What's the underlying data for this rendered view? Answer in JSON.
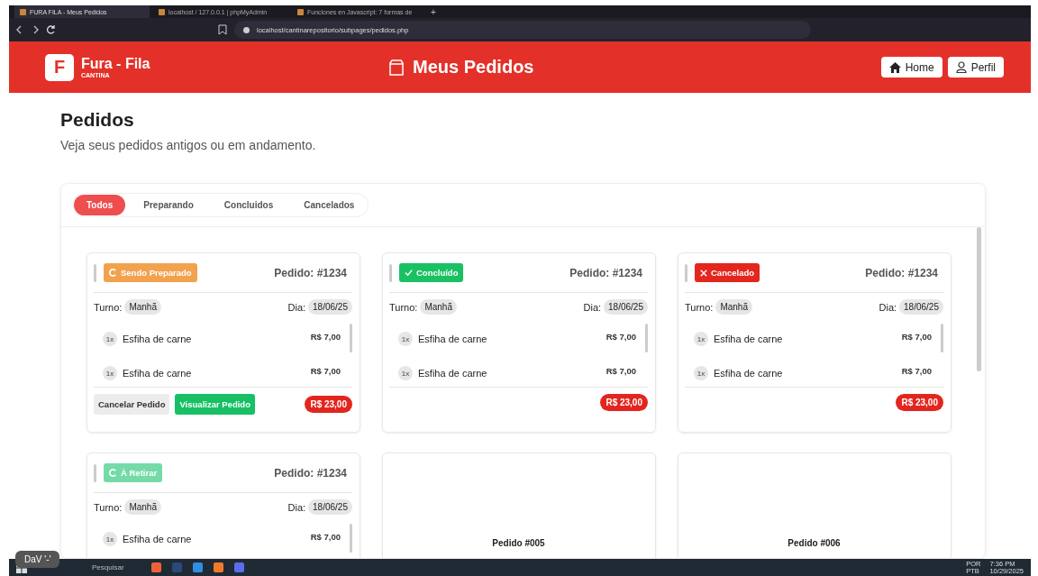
{
  "browser": {
    "tabs": [
      {
        "title": "FURA FILA - Meus Pedidos",
        "selected": true
      },
      {
        "title": "localhost / 127.0.0.1 | phpMyAdmin",
        "selected": false
      },
      {
        "title": "Funciones en Javascript: 7 formas de",
        "selected": false
      }
    ],
    "new_tab": "+",
    "url": "localhost/cantinarepositorio/subpages/pedidos.php"
  },
  "header": {
    "logo_letter": "F",
    "brand": "Fura - Fila",
    "subtitle": "CANTINA",
    "title": "Meus Pedidos",
    "buttons": [
      {
        "label": "Home",
        "kind": "home"
      },
      {
        "label": "Perfil",
        "kind": "profile"
      }
    ]
  },
  "page": {
    "title": "Pedidos",
    "subtitle": "Veja seus pedidos antigos ou em andamento."
  },
  "filters": [
    {
      "label": "Todos",
      "selected": true
    },
    {
      "label": "Preparando",
      "selected": false
    },
    {
      "label": "Concluidos",
      "selected": false
    },
    {
      "label": "Cancelados",
      "selected": false
    }
  ],
  "orders": [
    {
      "kind": "order",
      "badge": {
        "kind": "preparing",
        "label": "Sendo Preparado"
      },
      "number": "Pedido: #1234",
      "shift_label": "Turno:",
      "shift": "Manhã",
      "day_label": "Dia:",
      "date": "18/06/25",
      "items": [
        {
          "qty": "1x",
          "name": "Esfiha de carne",
          "price": "R$ 7,00"
        },
        {
          "qty": "1x",
          "name": "Esfiha de carne",
          "price": "R$ 7,00"
        }
      ],
      "actions": [
        {
          "label": "Cancelar Pedido",
          "kind": "cancel"
        },
        {
          "label": "Visualizar Pedido",
          "kind": "view"
        }
      ],
      "total": "R$ 23,00"
    },
    {
      "kind": "order",
      "badge": {
        "kind": "done",
        "label": "Concluído"
      },
      "number": "Pedido: #1234",
      "shift_label": "Turno:",
      "shift": "Manhã",
      "day_label": "Dia:",
      "date": "18/06/25",
      "items": [
        {
          "qty": "1x",
          "name": "Esfiha de carne",
          "price": "R$ 7,00"
        },
        {
          "qty": "1x",
          "name": "Esfiha de carne",
          "price": "R$ 7,00"
        }
      ],
      "total": "R$ 23,00"
    },
    {
      "kind": "order",
      "badge": {
        "kind": "cancelled",
        "label": "Cancelado"
      },
      "number": "Pedido: #1234",
      "shift_label": "Turno:",
      "shift": "Manhã",
      "day_label": "Dia:",
      "date": "18/06/25",
      "items": [
        {
          "qty": "1x",
          "name": "Esfiha de carne",
          "price": "R$ 7,00"
        },
        {
          "qty": "1x",
          "name": "Esfiha de carne",
          "price": "R$ 7,00"
        }
      ],
      "total": "R$ 23,00"
    },
    {
      "kind": "order",
      "badge": {
        "kind": "pickup",
        "label": "À Retirar"
      },
      "number": "Pedido: #1234",
      "shift_label": "Turno:",
      "shift": "Manhã",
      "day_label": "Dia:",
      "date": "18/06/25",
      "items": [
        {
          "qty": "1x",
          "name": "Esfiha de carne",
          "price": "R$ 7,00"
        }
      ]
    },
    {
      "kind": "placeholder",
      "title": "Pedido #005"
    },
    {
      "kind": "placeholder",
      "title": "Pedido #006"
    }
  ],
  "overlay_label": "DaV '-'",
  "taskbar": {
    "search": "Pesquisar",
    "lang": "POR",
    "layout": "PTB",
    "time": "7:36 PM",
    "date": "10/29/2025"
  }
}
